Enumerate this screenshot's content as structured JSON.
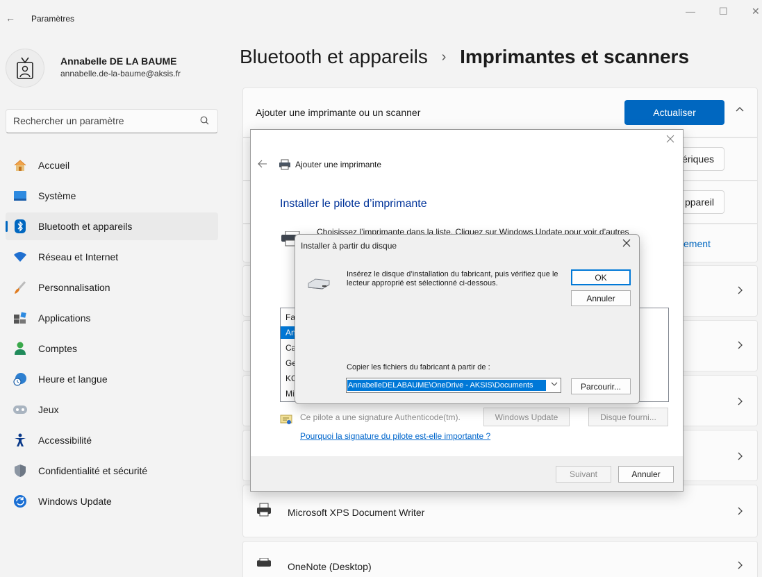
{
  "window": {
    "title": "Paramètres",
    "back_glyph": "←",
    "minimize_glyph": "—",
    "maximize_glyph": "☐",
    "close_glyph": "✕"
  },
  "profile": {
    "name": "Annabelle DE LA BAUME",
    "email": "annabelle.de-la-baume@aksis.fr"
  },
  "search": {
    "placeholder": "Rechercher un paramètre"
  },
  "nav": {
    "items": [
      {
        "label": "Accueil",
        "icon": "home-icon"
      },
      {
        "label": "Système",
        "icon": "system-icon"
      },
      {
        "label": "Bluetooth et appareils",
        "icon": "bluetooth-icon",
        "active": true
      },
      {
        "label": "Réseau et Internet",
        "icon": "wifi-icon"
      },
      {
        "label": "Personnalisation",
        "icon": "brush-icon"
      },
      {
        "label": "Applications",
        "icon": "apps-icon"
      },
      {
        "label": "Comptes",
        "icon": "person-icon"
      },
      {
        "label": "Heure et langue",
        "icon": "clock-globe-icon"
      },
      {
        "label": "Jeux",
        "icon": "gamepad-icon"
      },
      {
        "label": "Accessibilité",
        "icon": "accessibility-icon"
      },
      {
        "label": "Confidentialité et sécurité",
        "icon": "shield-icon"
      },
      {
        "label": "Windows Update",
        "icon": "update-icon"
      }
    ]
  },
  "header": {
    "parent": "Bluetooth et appareils",
    "separator": "›",
    "current": "Imprimantes et scanners"
  },
  "main": {
    "add_printer_label": "Ajouter une imprimante ou un scanner",
    "refresh_button": "Actualiser",
    "partial_button_1": "ériques",
    "partial_button_2": "ppareil",
    "partial_link": "ellement",
    "printers": [
      {
        "name": "Microsoft XPS Document Writer"
      },
      {
        "name": "OneNote (Desktop)"
      }
    ]
  },
  "add_printer_dialog": {
    "title": "Ajouter une imprimante",
    "heading": "Installer le pilote d’imprimante",
    "description": "Choisissez l’imprimante dans la liste. Cliquez sur Windows Update pour voir d’autres",
    "list_items": [
      "Fal",
      "An",
      "Ca",
      "Ge",
      "KC",
      "Mi"
    ],
    "signature_text": "Ce pilote a une signature Authenticode(tm).",
    "windows_update_button": "Windows Update",
    "have_disk_button": "Disque fourni...",
    "signature_link": "Pourquoi la signature du pilote est-elle importante ?",
    "next_button": "Suivant",
    "cancel_button": "Annuler"
  },
  "install_disk_dialog": {
    "title": "Installer à partir du disque",
    "message": "Insérez le disque d’installation du fabricant, puis vérifiez que le lecteur approprié est sélectionné ci-dessous.",
    "ok_button": "OK",
    "cancel_button": "Annuler",
    "copy_label": "Copier les fichiers du fabricant à partir de :",
    "path_value": "AnnabelleDELABAUME\\OneDrive - AKSIS\\Documents",
    "browse_button": "Parcourir..."
  },
  "colors": {
    "accent": "#0067c0",
    "selection": "#0078d7",
    "dialog_heading": "#003399"
  }
}
